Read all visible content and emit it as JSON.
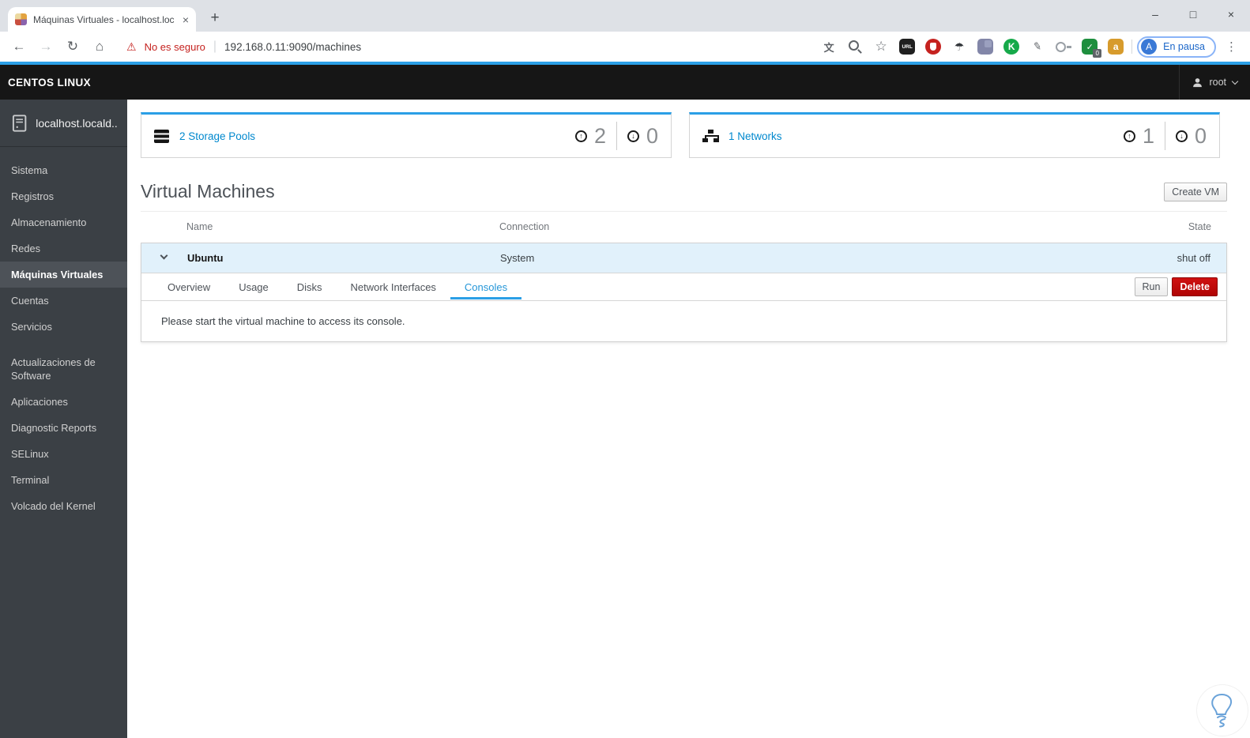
{
  "browser": {
    "tab": {
      "title": "Máquinas Virtuales - localhost.loc",
      "close_glyph": "×"
    },
    "new_tab_glyph": "+",
    "window_controls": {
      "minimize": "–",
      "maximize": "□",
      "close": "×"
    },
    "toolbar": {
      "back_glyph": "←",
      "forward_glyph": "→",
      "reload_glyph": "↻",
      "home_glyph": "⌂",
      "warning_glyph": "⚠",
      "security_warning": "No es seguro",
      "divider_glyph": "|",
      "url": "192.168.0.11:9090/machines",
      "menu_glyph": "⋮"
    },
    "extensions": [
      {
        "name": "translate-icon",
        "cls": "x-translate",
        "glyph": "文"
      },
      {
        "name": "zoom-out-icon",
        "cls": "x-zoom",
        "glyph": ""
      },
      {
        "name": "bookmark-star-icon",
        "cls": "x-star",
        "glyph": "☆"
      },
      {
        "name": "url-extension-icon",
        "cls": "x-url",
        "glyph": "URL"
      },
      {
        "name": "adblock-extension-icon",
        "cls": "x-adblock",
        "glyph": ""
      },
      {
        "name": "umbrella-extension-icon",
        "cls": "x-umbrella",
        "glyph": "☂"
      },
      {
        "name": "purple-extension-icon",
        "cls": "x-purple",
        "glyph": ""
      },
      {
        "name": "keepa-extension-icon",
        "cls": "x-keepa",
        "glyph": "K"
      },
      {
        "name": "brush-extension-icon",
        "cls": "x-brush",
        "glyph": "✎"
      },
      {
        "name": "lightbulb-extension-icon",
        "cls": "x-bulbext",
        "glyph": ""
      },
      {
        "name": "shield-check-extension-icon",
        "cls": "x-shield",
        "glyph": "✓",
        "badge": "0"
      },
      {
        "name": "shopping-extension-icon",
        "cls": "x-bag",
        "glyph": "a"
      }
    ],
    "profile": {
      "avatar_initial": "A",
      "label": "En pausa"
    }
  },
  "masthead": {
    "brand": "CENTOS LINUX",
    "user": "root"
  },
  "sidebar": {
    "host": "localhost.locald...",
    "items": [
      {
        "id": "sidebar-item-sistema",
        "label": "Sistema"
      },
      {
        "id": "sidebar-item-registros",
        "label": "Registros"
      },
      {
        "id": "sidebar-item-almacenamiento",
        "label": "Almacenamiento"
      },
      {
        "id": "sidebar-item-redes",
        "label": "Redes"
      },
      {
        "id": "sidebar-item-maquinas-virtuales",
        "label": "Máquinas Virtuales",
        "active": true
      },
      {
        "id": "sidebar-item-cuentas",
        "label": "Cuentas"
      },
      {
        "id": "sidebar-item-servicios",
        "label": "Servicios"
      },
      {
        "id": "sidebar-item-actualizaciones-de-software",
        "label": "Actualizaciones de Software",
        "gap": true
      },
      {
        "id": "sidebar-item-aplicaciones",
        "label": "Aplicaciones"
      },
      {
        "id": "sidebar-item-diagnostic-reports",
        "label": "Diagnostic Reports"
      },
      {
        "id": "sidebar-item-selinux",
        "label": "SELinux"
      },
      {
        "id": "sidebar-item-terminal",
        "label": "Terminal"
      },
      {
        "id": "sidebar-item-volcado-del-kernel",
        "label": "Volcado del Kernel"
      }
    ]
  },
  "overview_cards": {
    "up_glyph": "↑",
    "down_glyph": "↓",
    "storage": {
      "label": "2 Storage Pools",
      "up": "2",
      "down": "0"
    },
    "network": {
      "label": "1 Networks",
      "up": "1",
      "down": "0"
    }
  },
  "vm_section": {
    "title": "Virtual Machines",
    "create_button": "Create VM"
  },
  "vm_table": {
    "columns": [
      "Name",
      "Connection",
      "State"
    ],
    "row": {
      "name": "Ubuntu",
      "connection": "System",
      "state": "shut off"
    }
  },
  "vm_panel": {
    "tabs": [
      {
        "label": "Overview"
      },
      {
        "label": "Usage"
      },
      {
        "label": "Disks"
      },
      {
        "label": "Network Interfaces"
      },
      {
        "label": "Consoles",
        "active": true
      }
    ],
    "run_button": "Run",
    "delete_button": "Delete",
    "console_message": "Please start the virtual machine to access its console."
  },
  "colors": {
    "accent_blue": "#2b9fe6",
    "link_blue": "#0088ce",
    "danger_red": "#c00404",
    "row_highlight": "#e1f1fb",
    "masthead_bg": "#161616",
    "sidebar_bg": "#3b4045",
    "sidebar_active_bg": "#4d5258",
    "warning_red": "#c5221f"
  }
}
